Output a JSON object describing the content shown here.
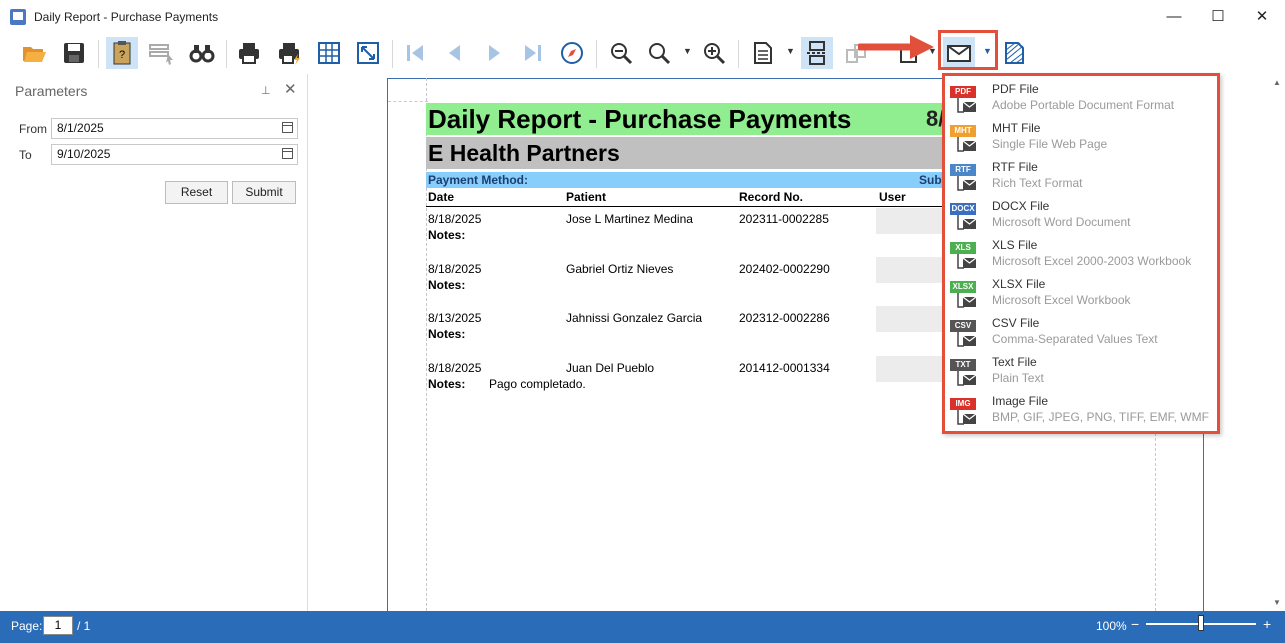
{
  "window": {
    "title": "Daily Report - Purchase Payments",
    "minimize_glyph": "—",
    "maximize_glyph": "☐",
    "close_glyph": "✕"
  },
  "toolbar": {
    "icons": [
      "open-icon",
      "save-icon",
      "parameters-icon",
      "document-map-icon",
      "search-icon",
      "print-icon",
      "quick-print-icon",
      "page-setup-icon",
      "scale-icon",
      "first-page-icon",
      "previous-page-icon",
      "next-page-icon",
      "last-page-icon",
      "navigation-icon",
      "zoom-out-icon",
      "zoom-icon",
      "zoom-in-icon",
      "view-mode-icon",
      "multiple-pages-icon",
      "color-icon",
      "export-icon",
      "email-icon",
      "watermark-icon"
    ]
  },
  "parameters": {
    "title": "Parameters",
    "pin_glyph": "⊥",
    "close_glyph": "✕",
    "from_label": "From",
    "from_value": "8/1/2025",
    "to_label": "To",
    "to_value": "9/10/2025",
    "reset_label": "Reset",
    "submit_label": "Submit"
  },
  "report": {
    "title": "Daily Report - Purchase Payments",
    "date_fragment": "8/",
    "company": "E Health Partners",
    "payment_method_label": "Payment Method:",
    "sub_fragment": "Sub",
    "columns": {
      "date": "Date",
      "patient": "Patient",
      "record": "Record No.",
      "user": "User"
    },
    "notes_label": "Notes:",
    "rows": [
      {
        "date": "8/18/2025",
        "patient": "Jose L Martinez Medina",
        "record": "202311-0002285",
        "notes": ""
      },
      {
        "date": "8/18/2025",
        "patient": "Gabriel Ortiz Nieves",
        "record": "202402-0002290",
        "notes": ""
      },
      {
        "date": "8/13/2025",
        "patient": "Jahnissi Gonzalez Garcia",
        "record": "202312-0002286",
        "notes": ""
      },
      {
        "date": "8/18/2025",
        "patient": "Juan Del Pueblo",
        "record": "201412-0001334",
        "notes": "Pago completado."
      }
    ]
  },
  "export_menu": {
    "items": [
      {
        "badge": "PDF",
        "color": "#d9322b",
        "name": "PDF File",
        "desc": "Adobe Portable Document Format"
      },
      {
        "badge": "MHT",
        "color": "#f0a030",
        "name": "MHT File",
        "desc": "Single File Web Page"
      },
      {
        "badge": "RTF",
        "color": "#4a86c8",
        "name": "RTF File",
        "desc": "Rich Text Format"
      },
      {
        "badge": "DOCX",
        "color": "#3a6fbf",
        "name": "DOCX File",
        "desc": "Microsoft Word Document"
      },
      {
        "badge": "XLS",
        "color": "#4caf50",
        "name": "XLS File",
        "desc": "Microsoft Excel 2000-2003 Workbook"
      },
      {
        "badge": "XLSX",
        "color": "#4caf50",
        "name": "XLSX File",
        "desc": "Microsoft Excel Workbook"
      },
      {
        "badge": "CSV",
        "color": "#555555",
        "name": "CSV File",
        "desc": "Comma-Separated Values Text"
      },
      {
        "badge": "TXT",
        "color": "#555555",
        "name": "Text File",
        "desc": "Plain Text"
      },
      {
        "badge": "IMG",
        "color": "#d9322b",
        "name": "Image File",
        "desc": "BMP, GIF, JPEG, PNG, TIFF, EMF, WMF"
      }
    ]
  },
  "statusbar": {
    "page_label": "Page:",
    "page_current": "1",
    "page_total": "/ 1",
    "zoom": "100%",
    "zoom_level": 0.5
  },
  "colors": {
    "accent": "#2b6cb8",
    "highlight": "#e2503c",
    "title_bar_green": "#90ee90",
    "company_bar_gray": "#c0c0c0",
    "method_bar_blue": "#87cefa"
  }
}
